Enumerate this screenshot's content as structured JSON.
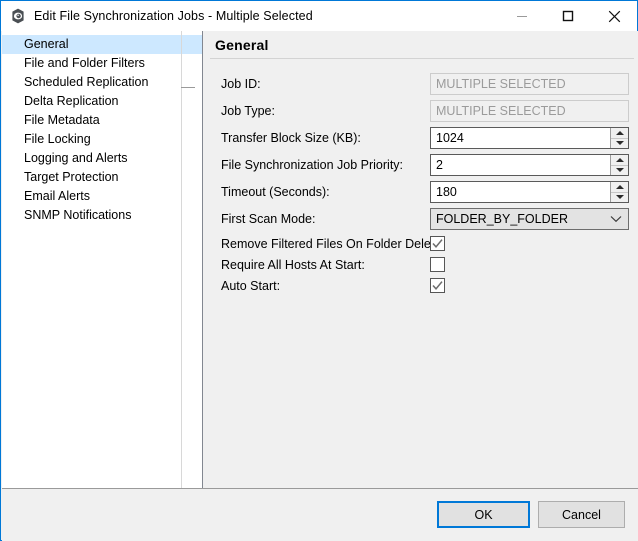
{
  "window": {
    "title": "Edit File Synchronization Jobs - Multiple Selected",
    "icon": "app-gear-icon",
    "controls": {
      "minimize": "minimize-icon",
      "maximize": "maximize-icon",
      "close": "close-icon"
    },
    "accent_color": "#0078d7",
    "panel_bg": "#f0f0f0",
    "selection_color": "#cde8ff"
  },
  "sidebar": {
    "items": [
      {
        "label": "General",
        "selected": true
      },
      {
        "label": "File and Folder Filters",
        "selected": false
      },
      {
        "label": "Scheduled Replication",
        "selected": false
      },
      {
        "label": "Delta Replication",
        "selected": false
      },
      {
        "label": "File Metadata",
        "selected": false
      },
      {
        "label": "File Locking",
        "selected": false
      },
      {
        "label": "Logging and Alerts",
        "selected": false
      },
      {
        "label": "Target Protection",
        "selected": false
      },
      {
        "label": "Email Alerts",
        "selected": false
      },
      {
        "label": "SNMP Notifications",
        "selected": false
      }
    ]
  },
  "panel": {
    "title": "General",
    "fields": {
      "job_id": {
        "label": "Job ID:",
        "value": "MULTIPLE SELECTED",
        "disabled": true
      },
      "job_type": {
        "label": "Job Type:",
        "value": "MULTIPLE SELECTED",
        "disabled": true
      },
      "transfer_block_size": {
        "label": "Transfer Block Size (KB):",
        "value": "1024"
      },
      "job_priority": {
        "label": "File Synchronization Job Priority:",
        "value": "2"
      },
      "timeout": {
        "label": "Timeout (Seconds):",
        "value": "180"
      },
      "first_scan_mode": {
        "label": "First Scan Mode:",
        "value": "FOLDER_BY_FOLDER"
      },
      "remove_filtered": {
        "label": "Remove Filtered Files On Folder Delete:",
        "checked": true
      },
      "require_all_hosts": {
        "label": "Require All Hosts At Start:",
        "checked": false
      },
      "auto_start": {
        "label": "Auto Start:",
        "checked": true
      }
    }
  },
  "footer": {
    "ok_label": "OK",
    "cancel_label": "Cancel"
  }
}
